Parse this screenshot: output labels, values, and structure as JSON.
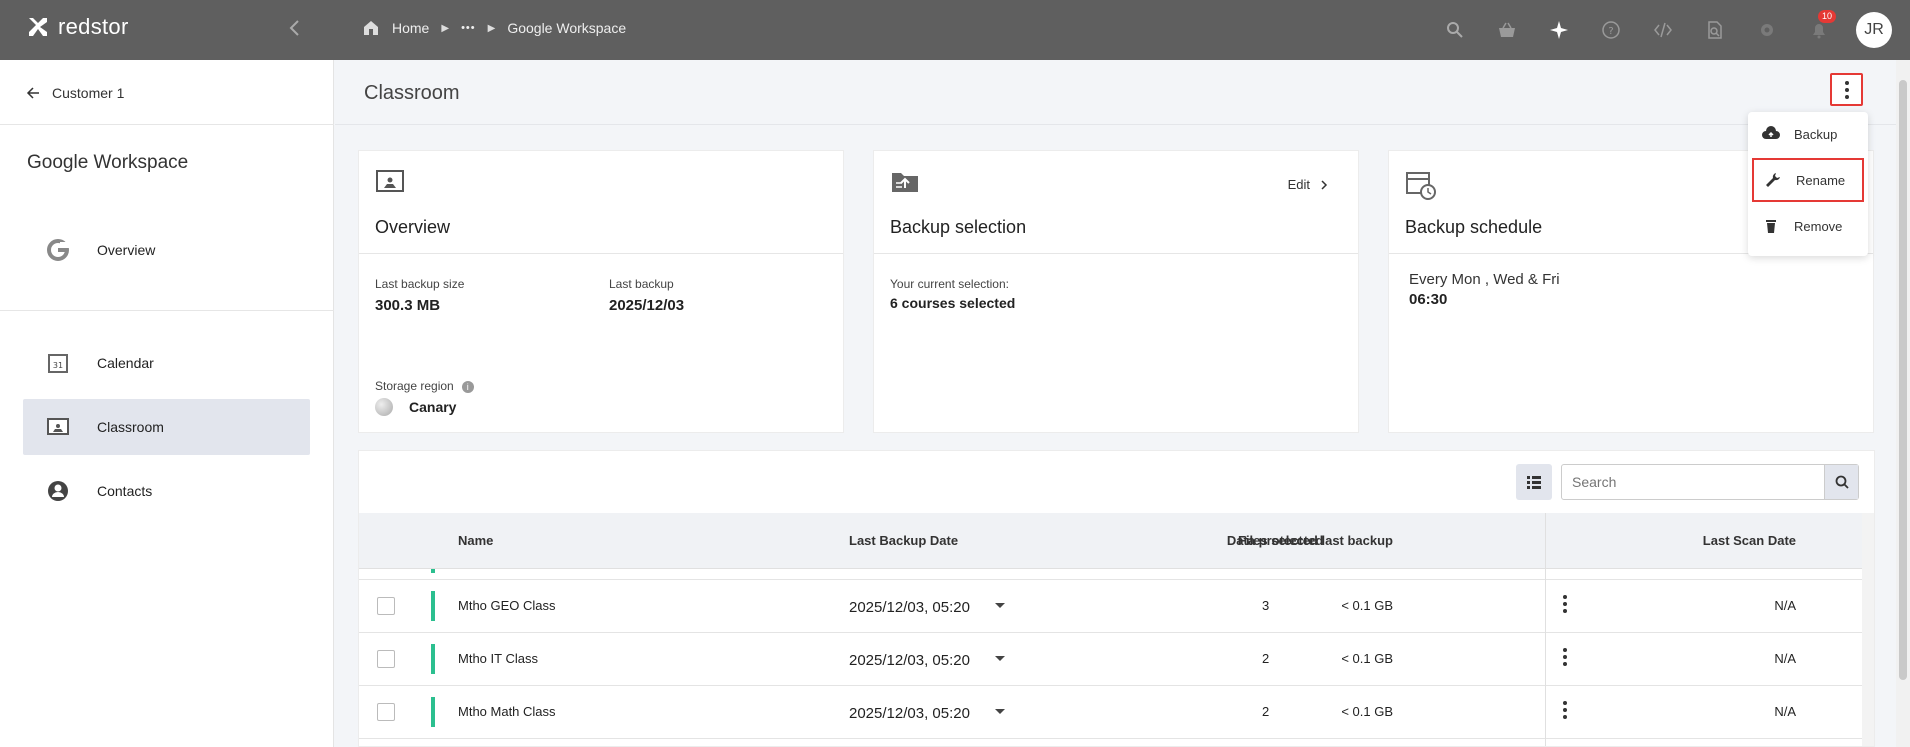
{
  "app": {
    "name": "redstor"
  },
  "breadcrumb": {
    "home": "Home",
    "ellipsis": "•••",
    "current": "Google Workspace"
  },
  "topbar": {
    "notifications_count": "10",
    "user_initials": "JR"
  },
  "sidebar": {
    "back_label": "Customer 1",
    "title": "Google Workspace",
    "items": [
      {
        "label": "Overview",
        "icon": "google-icon"
      },
      {
        "label": "Calendar",
        "icon": "calendar-icon"
      },
      {
        "label": "Classroom",
        "icon": "classroom-icon",
        "active": true
      },
      {
        "label": "Contacts",
        "icon": "contacts-icon"
      }
    ]
  },
  "page": {
    "title": "Classroom"
  },
  "cards": {
    "overview": {
      "title": "Overview",
      "last_backup_size_label": "Last backup size",
      "last_backup_size": "300.3 MB",
      "last_backup_label": "Last backup",
      "last_backup": "2025/12/03",
      "storage_region_label": "Storage region",
      "storage_region": "Canary"
    },
    "selection": {
      "title": "Backup selection",
      "edit_label": "Edit",
      "current_label": "Your current selection:",
      "current_value": "6 courses selected"
    },
    "schedule": {
      "title": "Backup schedule",
      "days": "Every Mon , Wed & Fri",
      "time": "06:30"
    }
  },
  "menu": {
    "items": [
      {
        "label": "Backup",
        "icon": "cloud-upload-icon"
      },
      {
        "label": "Rename",
        "icon": "wrench-icon"
      },
      {
        "label": "Remove",
        "icon": "trash-icon"
      }
    ]
  },
  "table": {
    "search_placeholder": "Search",
    "columns": {
      "name": "Name",
      "last_backup_date": "Last Backup Date",
      "data_protected": "Data protected last backup",
      "files_selected": "Files selected",
      "last_scan_date": "Last Scan Date"
    },
    "rows": [
      {
        "name": "Mtho GEO Class",
        "date": "2025/12/03, 05:20",
        "data": "< 0.1 GB",
        "files": "3",
        "scan": "N/A"
      },
      {
        "name": "Mtho IT Class",
        "date": "2025/12/03, 05:20",
        "data": "< 0.1 GB",
        "files": "2",
        "scan": "N/A"
      },
      {
        "name": "Mtho Math Class",
        "date": "2025/12/03, 05:20",
        "data": "< 0.1 GB",
        "files": "2",
        "scan": "N/A"
      }
    ]
  },
  "colors": {
    "topbar": "#5f5f5f",
    "accent_status": "#2bbf8f",
    "highlight": "#e53935",
    "active_bg": "#e2e5ed"
  }
}
